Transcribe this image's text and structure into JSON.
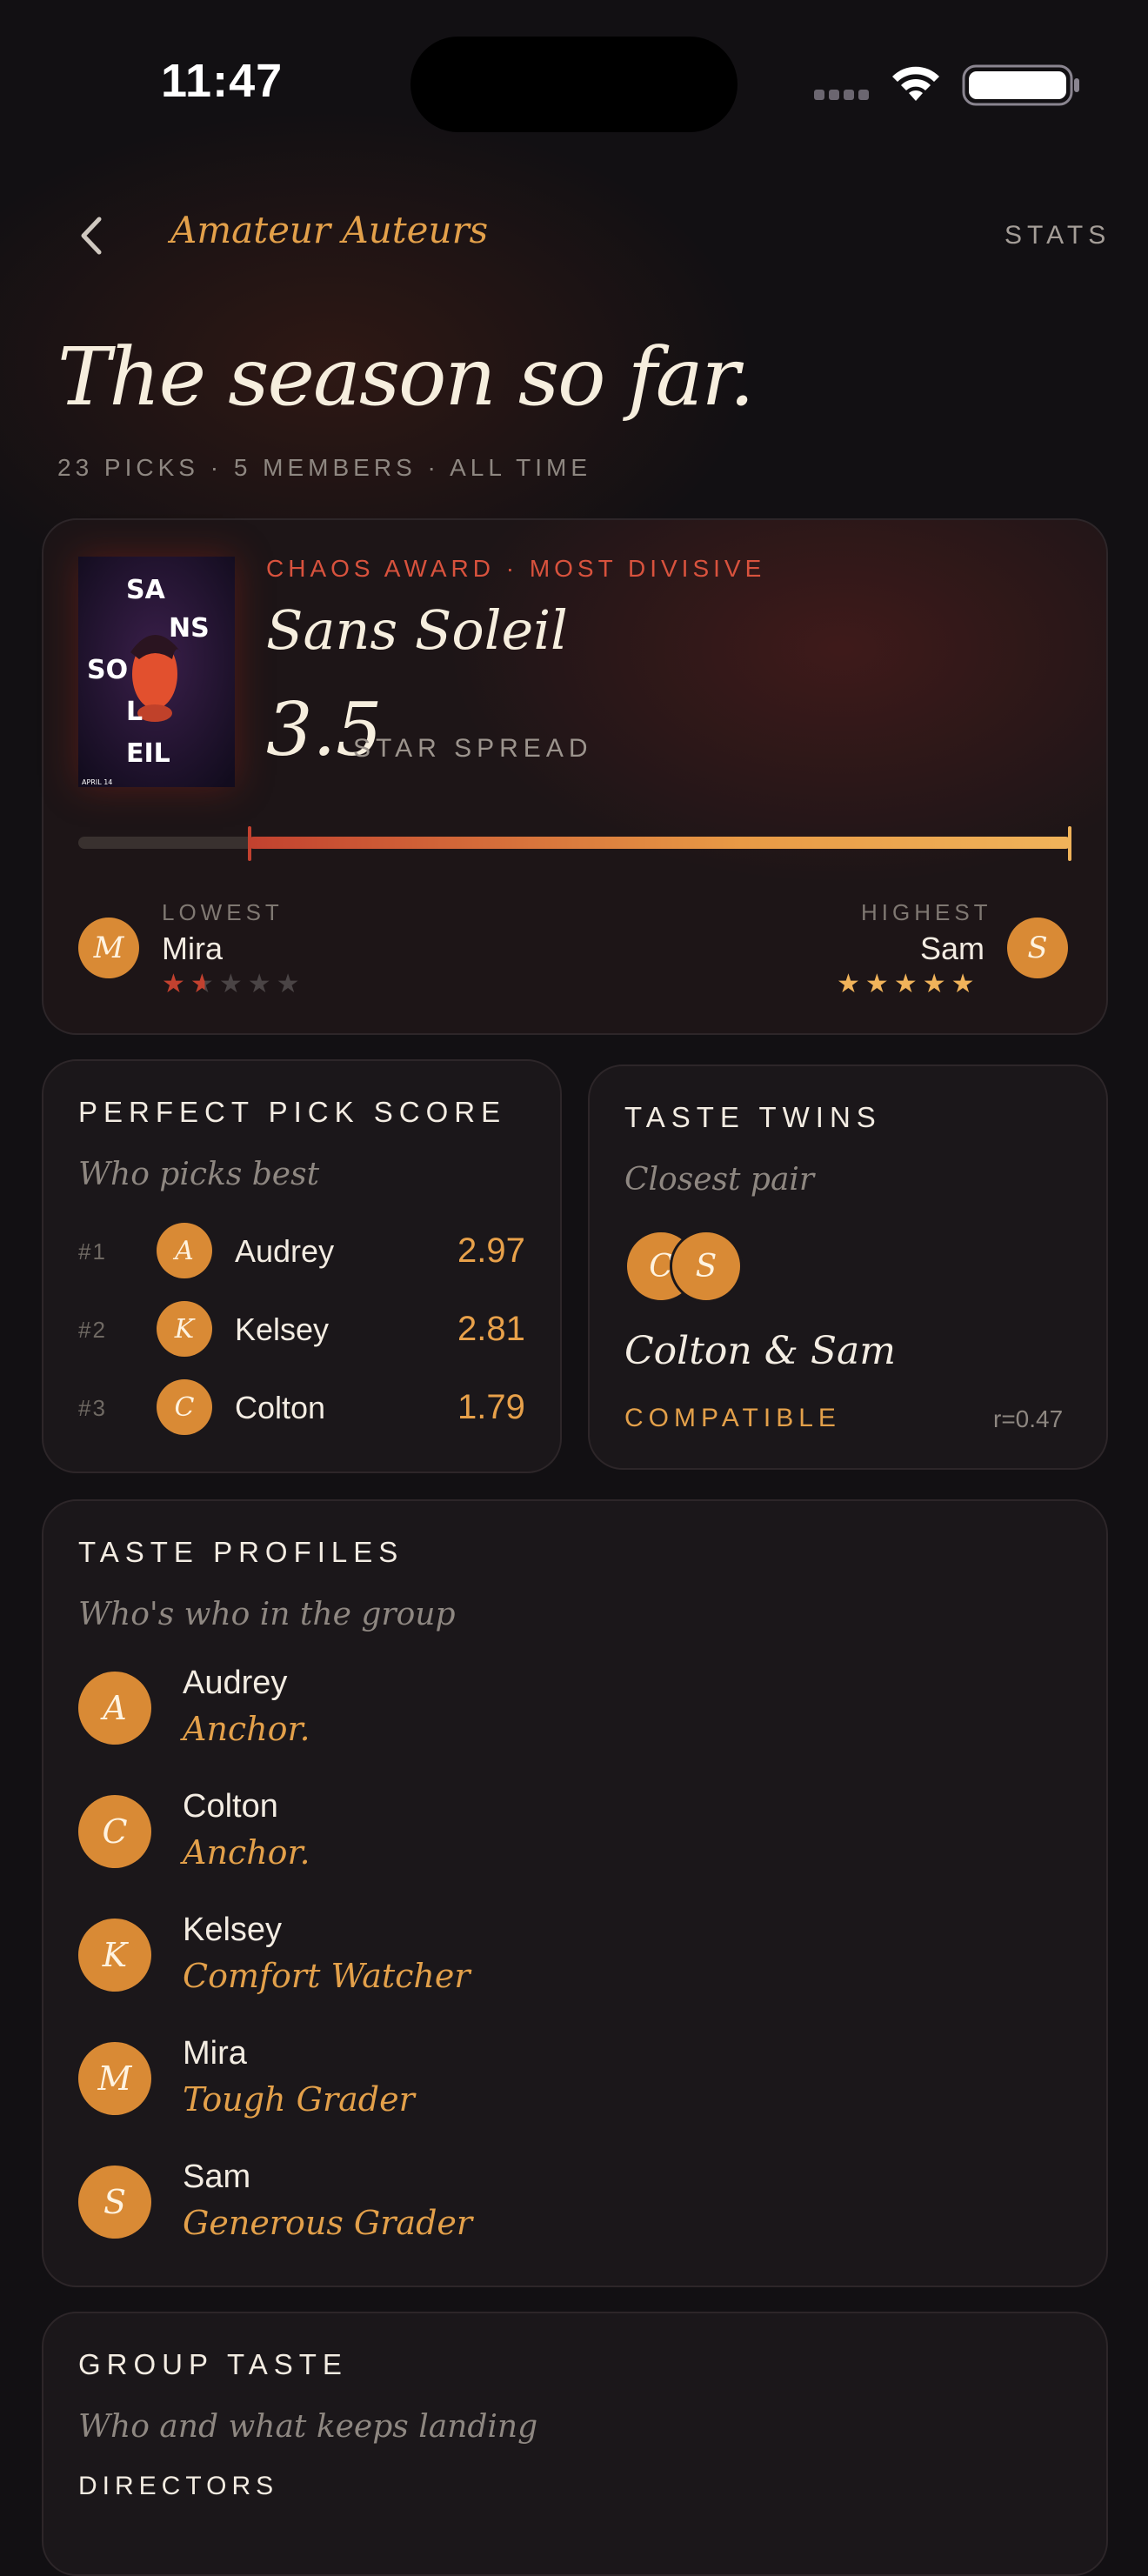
{
  "status": {
    "time": "11:47"
  },
  "nav": {
    "club_name": "Amateur Auteurs",
    "stats_label": "STATS"
  },
  "page": {
    "title": "The season so far.",
    "meta": "23 PICKS · 5 MEMBERS · ALL TIME"
  },
  "chaos": {
    "eyebrow": "CHAOS AWARD · MOST DIVISIVE",
    "film": "Sans Soleil",
    "spread": "3.5",
    "spread_label": "STAR SPREAD",
    "poster_lines": [
      "SA",
      "NS",
      "SO",
      "L",
      "EIL"
    ],
    "poster_date": "APRIL 14",
    "lowest": {
      "label": "LOWEST",
      "name": "Mira",
      "initial": "M",
      "rating": 1.5
    },
    "highest": {
      "label": "HIGHEST",
      "name": "Sam",
      "initial": "S",
      "rating": 5
    },
    "colors": {
      "low": "#c2412f",
      "high": "#f0b35a"
    }
  },
  "perfect_pick": {
    "title": "PERFECT PICK SCORE",
    "subtitle": "Who picks best",
    "rows": [
      {
        "rank": "#1",
        "initial": "A",
        "name": "Audrey",
        "score": "2.97"
      },
      {
        "rank": "#2",
        "initial": "K",
        "name": "Kelsey",
        "score": "2.81"
      },
      {
        "rank": "#3",
        "initial": "C",
        "name": "Colton",
        "score": "1.79"
      }
    ]
  },
  "taste_twins": {
    "title": "TASTE TWINS",
    "subtitle": "Closest pair",
    "initials": [
      "C",
      "S"
    ],
    "pair": "Colton & Sam",
    "verdict": "COMPATIBLE",
    "r_value": "r=0.47"
  },
  "taste_profiles": {
    "title": "TASTE PROFILES",
    "subtitle": "Who's who in the group",
    "members": [
      {
        "initial": "A",
        "name": "Audrey",
        "role": "Anchor."
      },
      {
        "initial": "C",
        "name": "Colton",
        "role": "Anchor."
      },
      {
        "initial": "K",
        "name": "Kelsey",
        "role": "Comfort Watcher"
      },
      {
        "initial": "M",
        "name": "Mira",
        "role": "Tough Grader"
      },
      {
        "initial": "S",
        "name": "Sam",
        "role": "Generous Grader"
      }
    ]
  },
  "group_taste": {
    "title": "GROUP TASTE",
    "subtitle": "Who and what keeps landing",
    "directors_label": "DIRECTORS"
  },
  "theme": {
    "accent": "#e3a04a",
    "avatar": "#d98a35",
    "danger": "#d8523d",
    "background": "#121013"
  }
}
